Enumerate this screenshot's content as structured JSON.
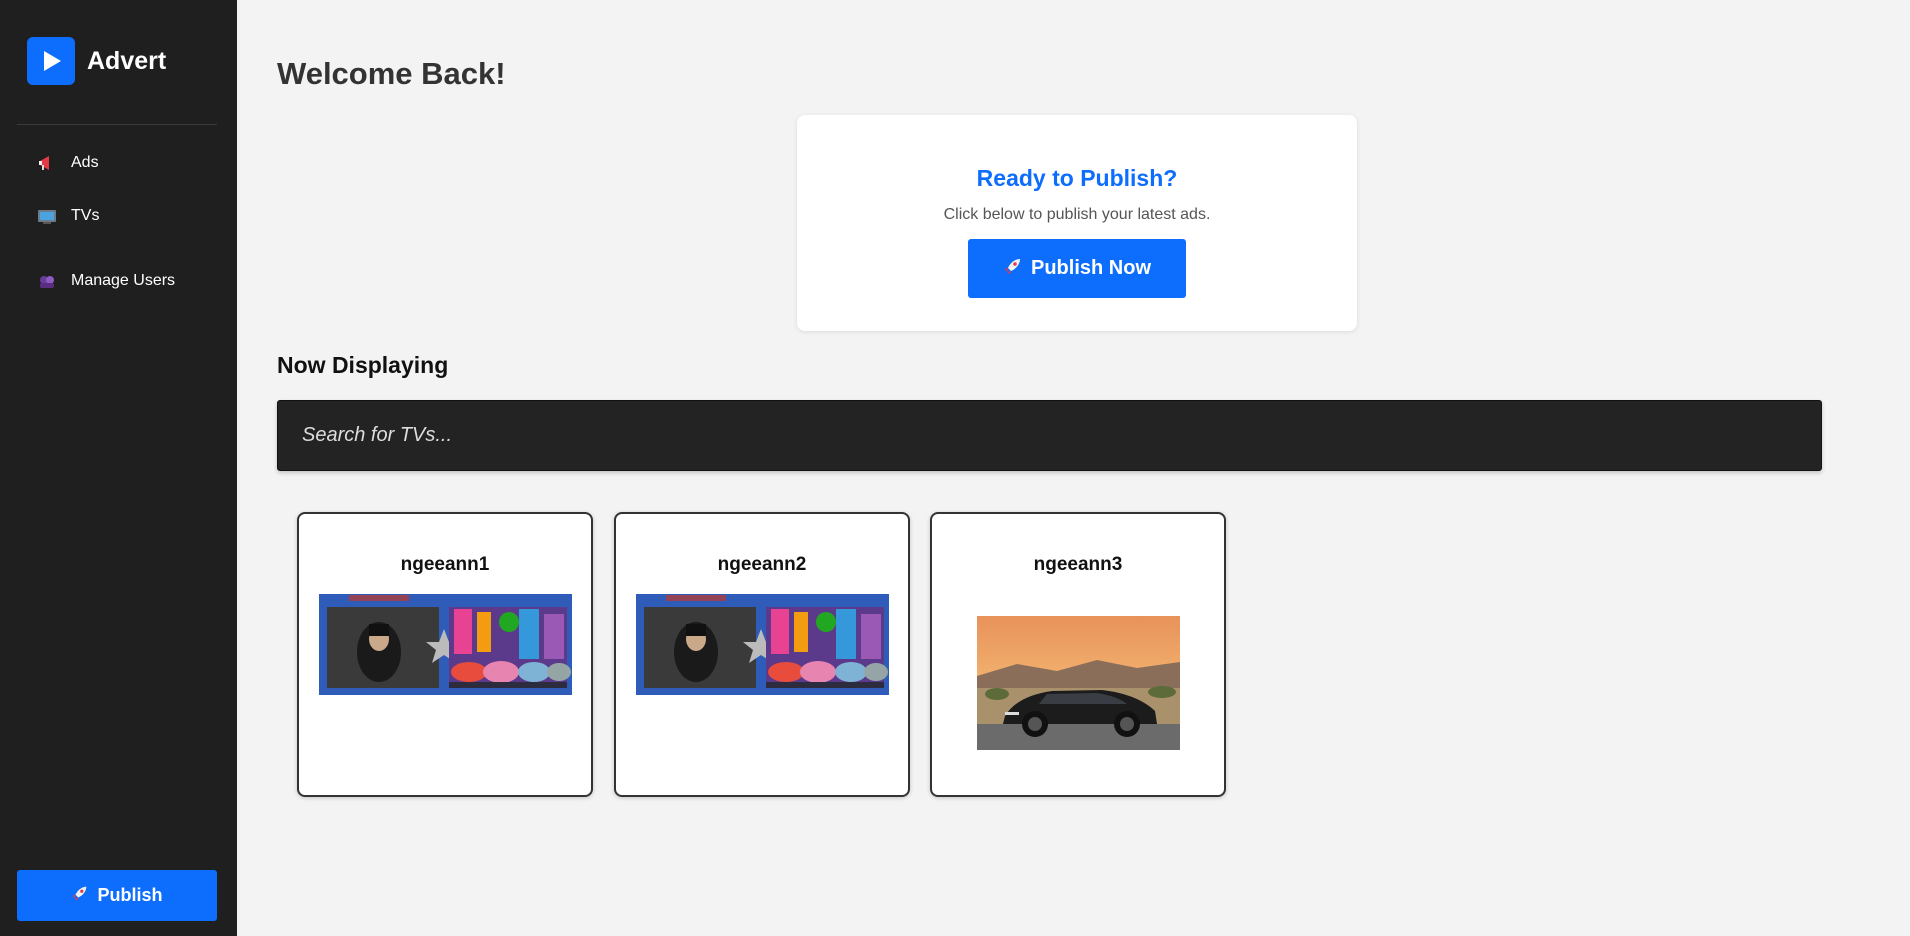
{
  "app": {
    "brand_name": "Advert",
    "brand_color": "#0d6efd"
  },
  "sidebar": {
    "items": [
      {
        "label": "Ads",
        "icon": "megaphone-icon"
      },
      {
        "label": "TVs",
        "icon": "television-icon"
      },
      {
        "label": "Manage Users",
        "icon": "users-icon"
      }
    ],
    "publish_label": "Publish",
    "publish_icon": "rocket-icon"
  },
  "main": {
    "title": "Welcome Back!",
    "publish_card": {
      "heading": "Ready to Publish?",
      "description": "Click below to publish your latest ads.",
      "button_label": "Publish Now",
      "button_icon": "rocket-icon"
    },
    "section_title": "Now Displaying",
    "search": {
      "placeholder": "Search for TVs...",
      "value": ""
    },
    "tvs": [
      {
        "name": "ngeeann1",
        "thumbnail": "batman-cars-banner"
      },
      {
        "name": "ngeeann2",
        "thumbnail": "batman-cars-banner"
      },
      {
        "name": "ngeeann3",
        "thumbnail": "sports-car-sunset"
      }
    ]
  },
  "colors": {
    "sidebar_bg": "#1f1f1f",
    "page_bg": "#f3f3f3",
    "accent": "#0d6efd",
    "search_bg": "#232323"
  }
}
